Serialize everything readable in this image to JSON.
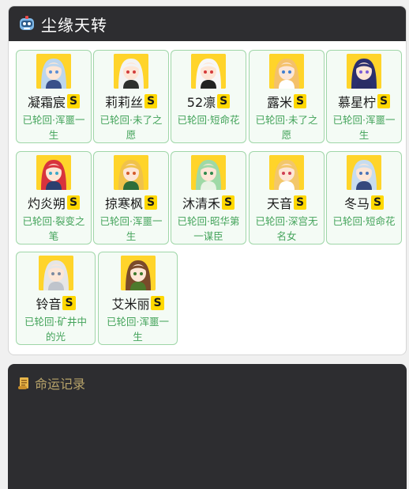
{
  "header": {
    "title": "尘缘天转",
    "icon": "robot-face-icon"
  },
  "characters": [
    {
      "name": "凝霜宸",
      "rank": "S",
      "status": "已轮回·浑噩一生",
      "hair": "#bcd6ee",
      "eyes": "#5c8fd6",
      "cloth": "#3a4f8a"
    },
    {
      "name": "莉莉丝",
      "rank": "S",
      "status": "已轮回·未了之愿",
      "hair": "#f3f3f3",
      "eyes": "#d23c3c",
      "cloth": "#2e2e2e"
    },
    {
      "name": "52凛",
      "rank": "S",
      "status": "已轮回·短命花",
      "hair": "#f7f7f7",
      "eyes": "#d43a3a",
      "cloth": "#222222"
    },
    {
      "name": "露米",
      "rank": "S",
      "status": "已轮回·未了之愿",
      "hair": "#f4c16a",
      "eyes": "#3f7fd0",
      "cloth": "#ffffff"
    },
    {
      "name": "慕星柠",
      "rank": "S",
      "status": "已轮回·浑噩一生",
      "hair": "#2b2f6e",
      "eyes": "#7b5bd6",
      "cloth": "#2a2d66"
    },
    {
      "name": "灼炎朔",
      "rank": "S",
      "status": "已轮回·裂变之笔",
      "hair": "#d8333d",
      "eyes": "#3aa7c9",
      "cloth": "#2c3f6f"
    },
    {
      "name": "掠寒枫",
      "rank": "S",
      "status": "已轮回·浑噩一生",
      "hair": "#f0c24a",
      "eyes": "#d45a2a",
      "cloth": "#2f6d3a"
    },
    {
      "name": "沐清禾",
      "rank": "S",
      "status": "已轮回·昭华第一谋臣",
      "hair": "#9fd9a6",
      "eyes": "#2f8a4a",
      "cloth": "#e8f3e4"
    },
    {
      "name": "天音",
      "rank": "S",
      "status": "已轮回·深宫无名女",
      "hair": "#f3c76a",
      "eyes": "#cf3e53",
      "cloth": "#ffffff"
    },
    {
      "name": "冬马",
      "rank": "S",
      "status": "已轮回·短命花",
      "hair": "#c7dcef",
      "eyes": "#4a73b8",
      "cloth": "#34487e"
    },
    {
      "name": "铃音",
      "rank": "S",
      "status": "已轮回·矿井中的光",
      "hair": "#e6e6e6",
      "eyes": "#7c8aa0",
      "cloth": "#bfc4cc"
    },
    {
      "name": "艾米丽",
      "rank": "S",
      "status": "已轮回·浑噩一生",
      "hair": "#7a4a2a",
      "eyes": "#3b7a2c",
      "cloth": "#4d7a2c"
    }
  ],
  "log": {
    "title": "命运记录",
    "icon": "scroll-icon"
  },
  "colors": {
    "header_bg": "#2d2d30",
    "card_bg": "#f4fbf5",
    "card_border": "#9fd6a8",
    "status_text": "#43a35a",
    "rank_bg": "#ffd800",
    "avatar_bg": "#ffd42a",
    "log_title": "#b7a36a"
  }
}
